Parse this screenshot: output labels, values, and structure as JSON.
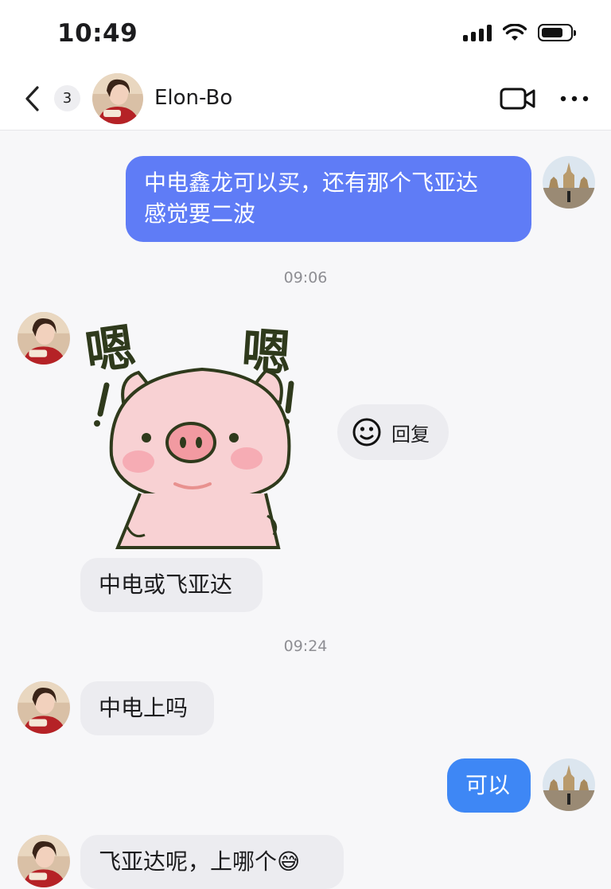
{
  "status_bar": {
    "time": "10:49",
    "icons": [
      "cellular-signal-icon",
      "wifi-icon",
      "battery-icon"
    ]
  },
  "header": {
    "unread_count": "3",
    "contact_name": "Elon-Bo",
    "icons": [
      "back-chevron-icon",
      "video-call-icon",
      "more-dots-icon"
    ]
  },
  "messages": [
    {
      "id": "m1",
      "direction": "out",
      "text_line1": "中电鑫龙可以买，还有那个飞亚达",
      "text_line2": "感觉要二波"
    },
    {
      "id": "ts1",
      "type": "timestamp",
      "text": "09:06"
    },
    {
      "id": "m2",
      "direction": "in",
      "type": "sticker",
      "sticker_text_left": "嗯",
      "sticker_text_right": "嗯",
      "reply_label": "回复"
    },
    {
      "id": "m3",
      "direction": "in",
      "text": "中电或飞亚达"
    },
    {
      "id": "ts2",
      "type": "timestamp",
      "text": "09:24"
    },
    {
      "id": "m4",
      "direction": "in",
      "text": "中电上吗"
    },
    {
      "id": "m5",
      "direction": "out",
      "text": "可以"
    },
    {
      "id": "m6",
      "direction": "in",
      "text": "飞亚达呢，上哪个",
      "emoji": "😅"
    }
  ],
  "colors": {
    "outgoing_bubble_1": "#5f7cf6",
    "outgoing_bubble_2": "#3e87f5",
    "incoming_bubble": "#ececf0",
    "background": "#f7f7f9"
  }
}
